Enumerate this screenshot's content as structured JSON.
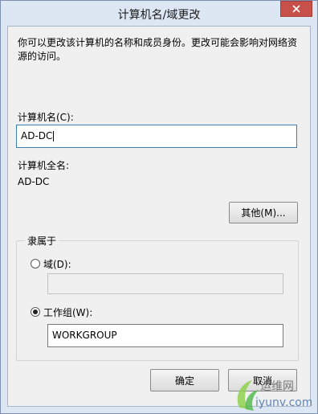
{
  "window": {
    "title": "计算机名/域更改"
  },
  "description": "你可以更改该计算机的名称和成员身份。更改可能会影响对网络资源的访问。",
  "computer_name": {
    "label": "计算机名(C):",
    "value": "AD-DC"
  },
  "full_name": {
    "label": "计算机全名:",
    "value": "AD-DC"
  },
  "buttons": {
    "more": "其他(M)...",
    "ok": "确定",
    "cancel": "取消"
  },
  "member_of": {
    "title": "隶属于",
    "domain": {
      "label": "域(D):",
      "selected": false,
      "value": ""
    },
    "workgroup": {
      "label": "工作组(W):",
      "selected": true,
      "value": "WORKGROUP"
    }
  },
  "watermark": {
    "text1": "运维网",
    "text2": "iyunv.com"
  },
  "colors": {
    "close_button": "#c7504a",
    "title_bg": "#dde6f3",
    "accent_border": "#3c7fb1"
  },
  "icons": [
    "close-icon",
    "watermark-logo-icon"
  ]
}
